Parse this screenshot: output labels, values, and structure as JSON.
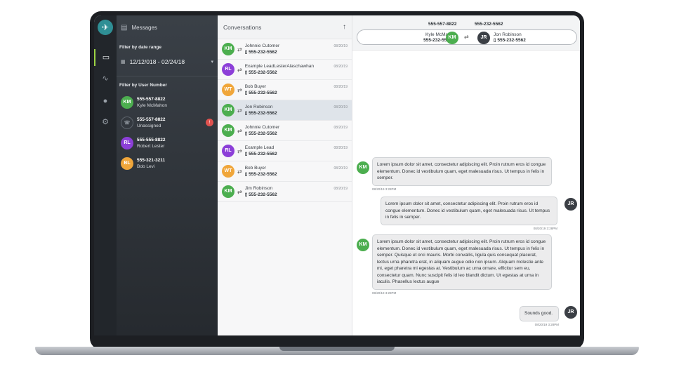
{
  "filter_panel": {
    "header": "Messages",
    "date_label": "Filter by date range",
    "date_value": "12/12/018 - 02/24/18",
    "user_label": "Filter by User Number",
    "users": [
      {
        "initials": "KM",
        "number": "555-557-8822",
        "name": "Kyle McMahon",
        "color": "#4cae4f"
      },
      {
        "initials": "",
        "number": "555-557-8822",
        "name": "Unassigned",
        "badge": "!"
      },
      {
        "initials": "RL",
        "number": "555-555-8822",
        "name": "Robert Lester",
        "color": "#8c3fd8"
      },
      {
        "initials": "BL",
        "number": "555-321-3211",
        "name": "Bob Levi",
        "color": "#f0a63a"
      }
    ]
  },
  "conversations": {
    "title": "Conversations",
    "items": [
      {
        "initials": "KM",
        "name": "Johnnie Cutomer",
        "number": "555-232-5562",
        "date": "08/20/19"
      },
      {
        "initials": "RL",
        "name": "Example LeadLesterAlaschawhan",
        "number": "555-232-5562",
        "date": "08/20/19"
      },
      {
        "initials": "WT",
        "name": "Bob Buyer",
        "number": "555-232-5562",
        "date": "08/20/19"
      },
      {
        "initials": "KM",
        "name": "Jon Robinson",
        "number": "555-232-5562",
        "date": "08/20/19",
        "selected": true
      },
      {
        "initials": "KM",
        "name": "Johnnie Cutomer",
        "number": "555-232-5562",
        "date": "08/20/19"
      },
      {
        "initials": "RL",
        "name": "Example Lead",
        "number": "555-232-5562",
        "date": "08/20/19"
      },
      {
        "initials": "WT",
        "name": "Bob Buyer",
        "number": "555-232-5562",
        "date": "08/20/19"
      },
      {
        "initials": "KM",
        "name": "Jim Robinson",
        "number": "555-232-5562",
        "date": "08/20/19"
      }
    ]
  },
  "chat": {
    "left_number": "555-557-8822",
    "right_number": "555-232-5562",
    "left_name": "Kyle McMahon",
    "left_phone": "555-232-5562",
    "left_initials": "KM",
    "right_initials": "JR",
    "right_name": "Jon Robinson",
    "right_phone": "555-232-5562",
    "messages": [
      {
        "from": "KM",
        "text": "Lorem ipsum dolor sit amet, consectetur adipiscing elit. Proin rutrum eros id congue elementum. Donec id vestibulum quam, eget malesuada risus. Ut tempus in felis in semper.",
        "time": "08/20/19 3:28PM"
      },
      {
        "from": "JR",
        "text": "Lorem ipsum dolor sit amet, consectetur adipiscing elit. Proin rutrum eros id congue elementum. Donec id vestibulum quam, eget malesuada risus. Ut tempus in felis in semper.",
        "time": "08/20/19 3:28PM"
      },
      {
        "from": "KM",
        "text": "Lorem ipsum dolor sit amet, consectetur adipiscing elit. Proin rutrum eros id congue elementum. Donec id vestibulum quam, eget malesuada risus. Ut tempus in felis in semper. Quisque et orci mauris. Morbi convallis, ligula quis consequat placerat, lectus urna pharetra erat, in aliquam augue odio non ipsum. Aliquam molestie ante mi, eget pharetra mi egestas at. Vestibulum ac urna ornare, efficitur sem eu, consectetur quam. Nunc suscipit felis id leo blandit dictum. Ut egestas at urna in iaculis. Phasellus lectus augue",
        "time": "08/20/19 3:28PM"
      },
      {
        "from": "JR",
        "text": "Sounds good.",
        "time": "08/20/19 3:28PM"
      }
    ]
  },
  "icons": {
    "logo": "logo-icon",
    "rail": [
      "messages-icon",
      "analytics-icon",
      "user-icon",
      "settings-icon"
    ]
  },
  "colors": {
    "accent": "#9dd444",
    "green": "#4cae4f",
    "purple": "#8c3fd8",
    "orange": "#f0a63a",
    "alert": "#e0524f"
  }
}
